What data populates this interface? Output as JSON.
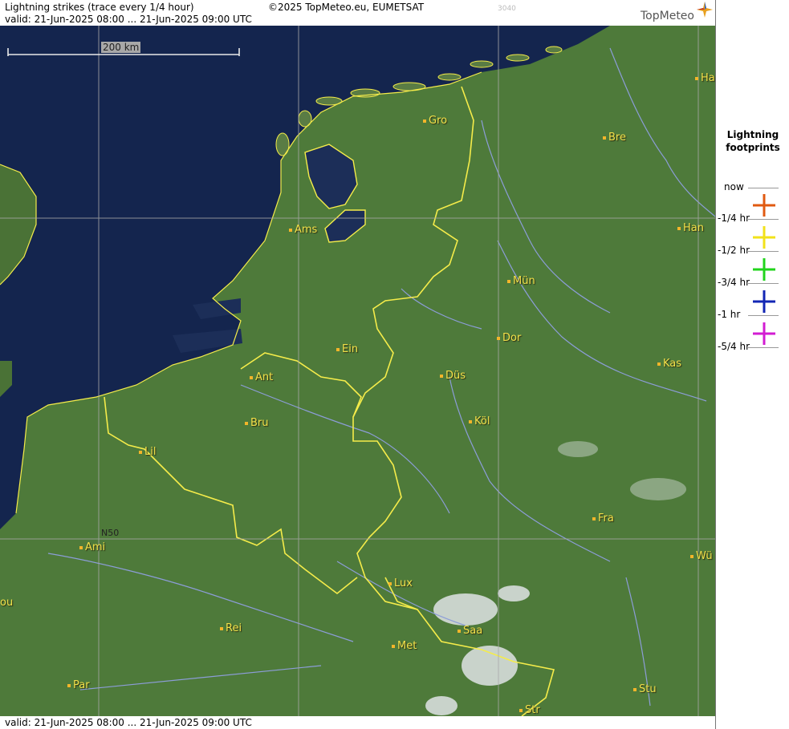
{
  "header": {
    "title": "Lightning strikes (trace every 1/4 hour)",
    "valid": "valid:  21-Jun-2025 08:00 ... 21-Jun-2025 09:00 UTC",
    "copyright": "©2025 TopMeteo.eu, EUMETSAT",
    "code": "3040",
    "logo": "TopMeteo"
  },
  "footer": {
    "valid": "valid:  21-Jun-2025 08:00 ... 21-Jun-2025 09:00 UTC"
  },
  "map": {
    "scale_label": "200 km",
    "grid_label": "N50",
    "cities": {
      "gro": "Gro",
      "bre": "Bre",
      "ham": "Ha",
      "ams": "Ams",
      "han": "Han",
      "mun": "Mün",
      "dor": "Dor",
      "ein": "Ein",
      "kas": "Kas",
      "ant": "Ant",
      "dus": "Düs",
      "bru": "Bru",
      "kol": "Köl",
      "lil": "Lil",
      "fra": "Fra",
      "ami": "Ami",
      "wur": "Wü",
      "lux": "Lux",
      "rou": "ou",
      "rei": "Rei",
      "saa": "Saa",
      "met": "Met",
      "stu": "Stu",
      "par": "Par",
      "str": "Str"
    }
  },
  "legend": {
    "title_line1": "Lightning",
    "title_line2": "footprints",
    "items": [
      {
        "label": "now",
        "color": "#e05a10"
      },
      {
        "label": "-1/4 hr",
        "color": "#f2e21a"
      },
      {
        "label": "-1/2 hr",
        "color": "#22d41c"
      },
      {
        "label": "-3/4 hr",
        "color": "#1226b4"
      },
      {
        "label": "-1 hr",
        "color": "#d21cd2"
      },
      {
        "label": "-5/4 hr",
        "color": ""
      }
    ]
  },
  "colors": {
    "sea": "#14254e",
    "land": "#4e7a3a",
    "border": "#f5ec4a",
    "river": "#8c9dd8",
    "grid": "#a9a9a9",
    "city": "#f1e04a"
  }
}
